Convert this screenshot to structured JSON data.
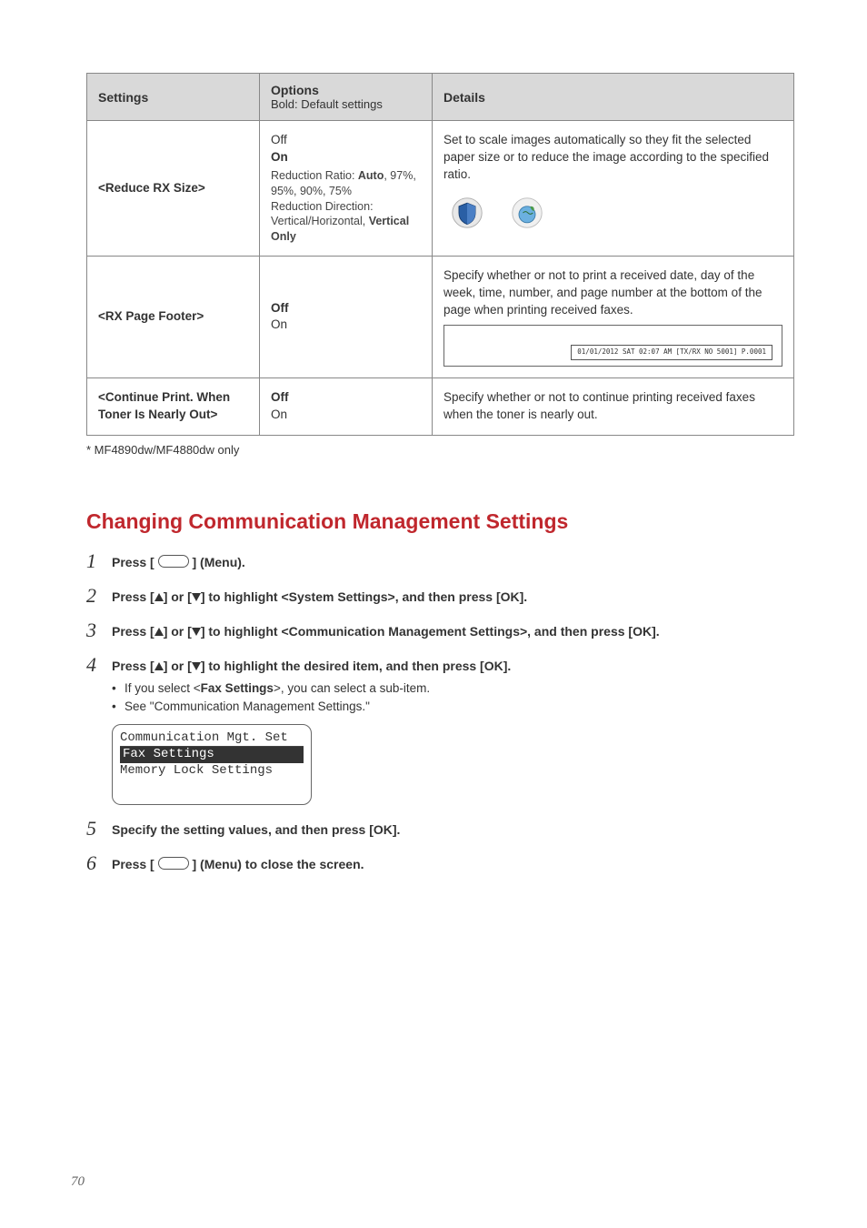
{
  "table": {
    "headers": {
      "settings": "Settings",
      "options": "Options",
      "options_sub": "Bold: Default settings",
      "details": "Details"
    },
    "rows": [
      {
        "setting": "<Reduce RX Size>",
        "options_lines": [
          "Off",
          "On"
        ],
        "options_sub1_a": "Reduction Ratio: ",
        "options_sub1_b": "Auto",
        "options_sub1_c": ", 97%, 95%, 90%, 75%",
        "options_sub2_a": "Reduction Direction: Vertical/Horizontal, ",
        "options_sub2_b": "Vertical Only",
        "details": "Set to scale images automatically so they fit the selected paper size or to reduce the image according to the specified ratio."
      },
      {
        "setting": "<RX Page Footer>",
        "options_bold": "Off",
        "options_plain": "On",
        "details": "Specify whether or not to print a received date, day of the week, time, number, and page number at the bottom of the page when printing received faxes.",
        "footer_sample": "01/01/2012 SAT 02:07 AM  [TX/RX NO 5001]  P.0001"
      },
      {
        "setting": "<Continue Print. When Toner Is Nearly Out>",
        "options_bold": "Off",
        "options_plain": "On",
        "details": "Specify whether or not to continue printing received faxes when the toner is nearly out."
      }
    ]
  },
  "footnote": "* MF4890dw/MF4880dw only",
  "section_title": "Changing Communication Management Settings",
  "steps": [
    {
      "num": "1",
      "pre": "Press [ ",
      "post": " ] (Menu)."
    },
    {
      "num": "2",
      "main_a": "Press [",
      "main_b": "] or [",
      "main_c": "] to highlight <System Settings>, and then press [OK]."
    },
    {
      "num": "3",
      "main_a": "Press [",
      "main_b": "] or [",
      "main_c": "] to highlight <Communication Management Settings>, and then press [OK]."
    },
    {
      "num": "4",
      "main_a": "Press [",
      "main_b": "] or [",
      "main_c": "] to highlight the desired item, and then press [OK].",
      "bullet1_a": "If you select <",
      "bullet1_b": "Fax Settings",
      "bullet1_c": ">, you can select a sub-item.",
      "bullet2": "See \"Communication Management Settings.\""
    },
    {
      "num": "5",
      "main": "Specify the setting values, and then press [OK]."
    },
    {
      "num": "6",
      "pre": "Press [ ",
      "post": " ] (Menu) to close the screen."
    }
  ],
  "lcd": {
    "line1": "Communication Mgt. Set",
    "line2": " Fax Settings",
    "line3": " Memory Lock Settings"
  },
  "page_number": "70"
}
